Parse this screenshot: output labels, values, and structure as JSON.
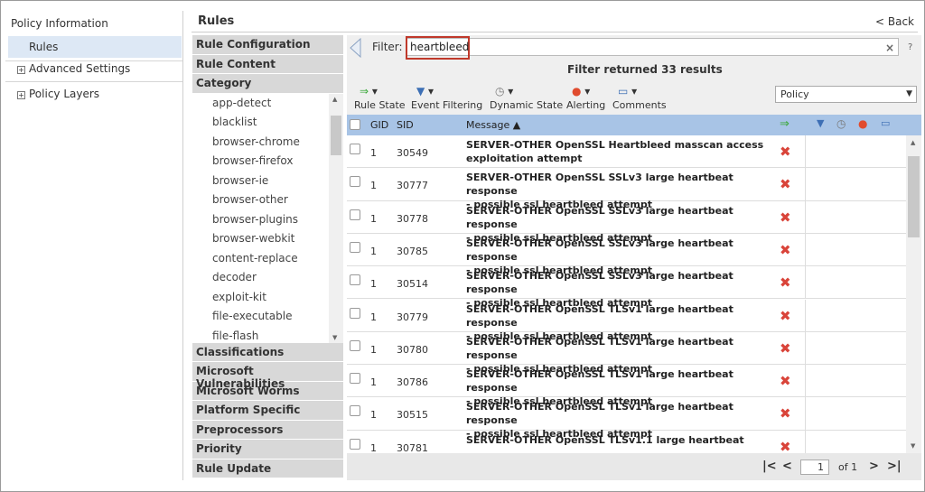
{
  "nav": {
    "title": "Policy Information",
    "items": [
      "Rules",
      "Advanced Settings",
      "Policy Layers"
    ]
  },
  "header": {
    "title": "Rules",
    "back": "< Back"
  },
  "accordion": {
    "top": [
      "Rule Configuration",
      "Rule Content",
      "Category"
    ],
    "categories": [
      "app-detect",
      "blacklist",
      "browser-chrome",
      "browser-firefox",
      "browser-ie",
      "browser-other",
      "browser-plugins",
      "browser-webkit",
      "content-replace",
      "decoder",
      "exploit-kit",
      "file-executable",
      "file-flash"
    ],
    "bottom": [
      "Classifications",
      "Microsoft Vulnerabilities",
      "Microsoft Worms",
      "Platform Specific",
      "Preprocessors",
      "Priority",
      "Rule Update"
    ]
  },
  "filter": {
    "label": "Filter:",
    "value": "heartbleed",
    "clear": "×",
    "help": "?",
    "result": "Filter returned 33 results"
  },
  "toolbar": {
    "rule_state": "Rule State",
    "event_filtering": "Event Filtering",
    "dynamic_state": "Dynamic State",
    "alerting": "Alerting",
    "comments": "Comments",
    "policy_select": "Policy"
  },
  "table": {
    "col_gid": "GID",
    "col_sid": "SID",
    "col_message": "Message ▲",
    "rows": [
      {
        "gid": "1",
        "sid": "30549",
        "msg1": "SERVER-OTHER OpenSSL Heartbleed masscan access",
        "msg2": "exploitation attempt"
      },
      {
        "gid": "1",
        "sid": "30777",
        "msg1": "SERVER-OTHER OpenSSL SSLv3 large heartbeat response",
        "msg2": "- possible ssl heartbleed attempt"
      },
      {
        "gid": "1",
        "sid": "30778",
        "msg1": "SERVER-OTHER OpenSSL SSLv3 large heartbeat response",
        "msg2": "- possible ssl heartbleed attempt"
      },
      {
        "gid": "1",
        "sid": "30785",
        "msg1": "SERVER-OTHER OpenSSL SSLv3 large heartbeat response",
        "msg2": "- possible ssl heartbleed attempt"
      },
      {
        "gid": "1",
        "sid": "30514",
        "msg1": "SERVER-OTHER OpenSSL SSLv3 large heartbeat response",
        "msg2": "- possible ssl heartbleed attempt"
      },
      {
        "gid": "1",
        "sid": "30779",
        "msg1": "SERVER-OTHER OpenSSL TLSv1 large heartbeat response",
        "msg2": "- possible ssl heartbleed attempt"
      },
      {
        "gid": "1",
        "sid": "30780",
        "msg1": "SERVER-OTHER OpenSSL TLSv1 large heartbeat response",
        "msg2": "- possible ssl heartbleed attempt"
      },
      {
        "gid": "1",
        "sid": "30786",
        "msg1": "SERVER-OTHER OpenSSL TLSv1 large heartbeat response",
        "msg2": "- possible ssl heartbleed attempt"
      },
      {
        "gid": "1",
        "sid": "30515",
        "msg1": "SERVER-OTHER OpenSSL TLSv1 large heartbeat response",
        "msg2": "- possible ssl heartbleed attempt"
      },
      {
        "gid": "1",
        "sid": "30781",
        "msg1": "SERVER-OTHER OpenSSL TLSv1.1 large heartbeat",
        "msg2": ""
      }
    ]
  },
  "pager": {
    "page": "1",
    "of": "of 1"
  },
  "colors": {
    "header_blue": "#a8c4e6",
    "selected_nav": "#dde8f5",
    "disabled_red": "#d9443a",
    "filter_highlight": "#c0392b"
  },
  "icons": {
    "rule_state": "green-arrow-icon",
    "event_filtering": "funnel-icon",
    "dynamic_state": "clock-icon",
    "alerting": "alert-icon",
    "comments": "comment-icon",
    "rule_disabled": "red-x-icon"
  }
}
